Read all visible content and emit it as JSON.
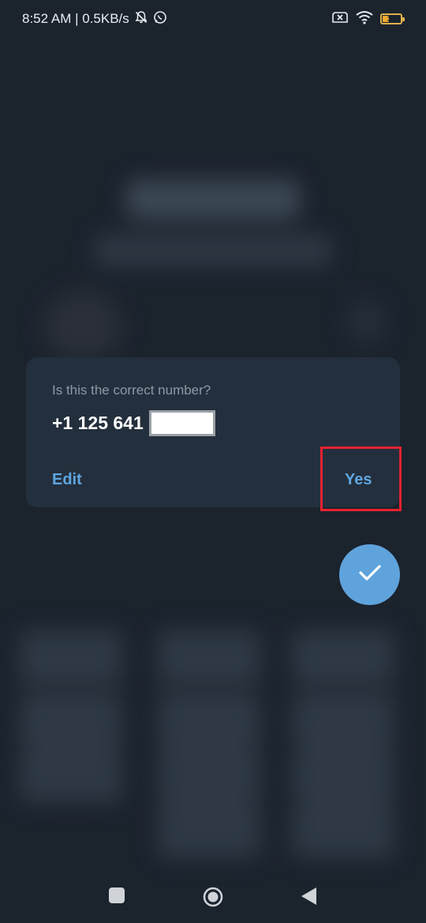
{
  "status_bar": {
    "time_speed": "8:52 AM | 0.5KB/s",
    "battery_level": "35",
    "icons": [
      "bell-muted-icon",
      "whatsapp-icon",
      "sim-off-icon",
      "wifi-icon",
      "battery-icon"
    ]
  },
  "dialog": {
    "question": "Is this the correct number?",
    "phone_number": "+1 125 641",
    "edit_label": "Edit",
    "yes_label": "Yes"
  },
  "fab": {
    "icon": "check-icon"
  },
  "nav_bar": {
    "icons": [
      "recents-square-icon",
      "home-circle-icon",
      "back-triangle-icon"
    ]
  },
  "colors": {
    "background": "#1b232d",
    "dialog": "#242f3d",
    "accent": "#5ea5e0",
    "fab": "#5fa3dd",
    "highlight": "#e8212f"
  }
}
